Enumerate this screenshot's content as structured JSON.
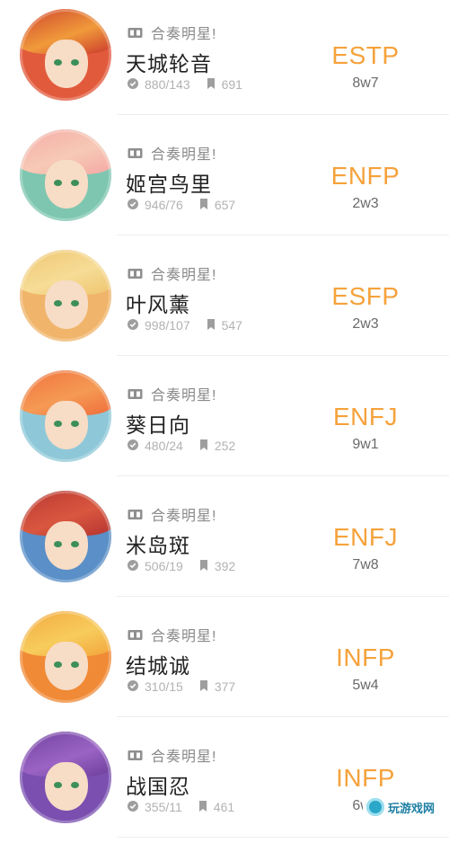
{
  "rows": [
    {
      "source": "合奏明星!",
      "name": "天城轮音",
      "views": "880/143",
      "saves": "691",
      "mbti": "ESTP",
      "wing": "8w7",
      "hair": "#c8332b",
      "hair2": "#f09a3a",
      "bg": "#e25a3c"
    },
    {
      "source": "合奏明星!",
      "name": "姬宫鸟里",
      "views": "946/76",
      "saves": "657",
      "mbti": "ENFP",
      "wing": "2w3",
      "hair": "#f4a6a3",
      "hair2": "#f7c9b6",
      "bg": "#7ec6b0"
    },
    {
      "source": "合奏明星!",
      "name": "叶风薰",
      "views": "998/107",
      "saves": "547",
      "mbti": "ESFP",
      "wing": "2w3",
      "hair": "#eec36c",
      "hair2": "#f6dc96",
      "bg": "#f0b56a"
    },
    {
      "source": "合奏明星!",
      "name": "葵日向",
      "views": "480/24",
      "saves": "252",
      "mbti": "ENFJ",
      "wing": "9w1",
      "hair": "#ef6a3a",
      "hair2": "#f59a54",
      "bg": "#8ec8d8"
    },
    {
      "source": "合奏明星!",
      "name": "米岛斑",
      "views": "506/19",
      "saves": "392",
      "mbti": "ENFJ",
      "wing": "7w8",
      "hair": "#b3312f",
      "hair2": "#d9573f",
      "bg": "#5a8fc7"
    },
    {
      "source": "合奏明星!",
      "name": "结城诚",
      "views": "310/15",
      "saves": "377",
      "mbti": "INFP",
      "wing": "5w4",
      "hair": "#f2a23a",
      "hair2": "#f7cc5c",
      "bg": "#f08a36"
    },
    {
      "source": "合奏明星!",
      "name": "战国忍",
      "views": "355/11",
      "saves": "461",
      "mbti": "INFP",
      "wing": "6w7",
      "hair": "#6a3c9a",
      "hair2": "#9a63c4",
      "bg": "#7a4fb0"
    }
  ],
  "watermark": {
    "text": "玩游戏网"
  }
}
